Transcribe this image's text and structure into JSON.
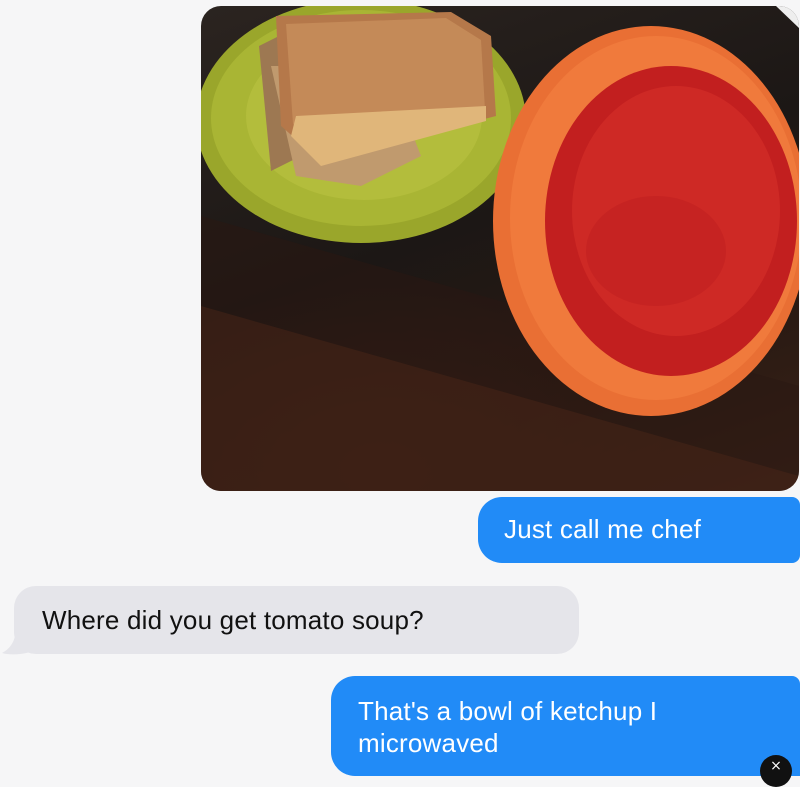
{
  "messages": [
    {
      "direction": "outgoing",
      "type": "image",
      "icon": "grilled-cheese-and-red-soup-photo"
    },
    {
      "direction": "outgoing",
      "type": "text",
      "text": "Just call me chef"
    },
    {
      "direction": "incoming",
      "type": "text",
      "text": "Where did you get tomato soup?"
    },
    {
      "direction": "outgoing",
      "type": "text",
      "text": "That's a bowl of ketchup I microwaved"
    }
  ],
  "colors": {
    "outgoing_bubble": "#218bf7",
    "incoming_bubble": "#e5e5ea",
    "background": "#f6f6f7"
  },
  "overlay": {
    "close_glyph": "×",
    "icon": "close-icon"
  }
}
